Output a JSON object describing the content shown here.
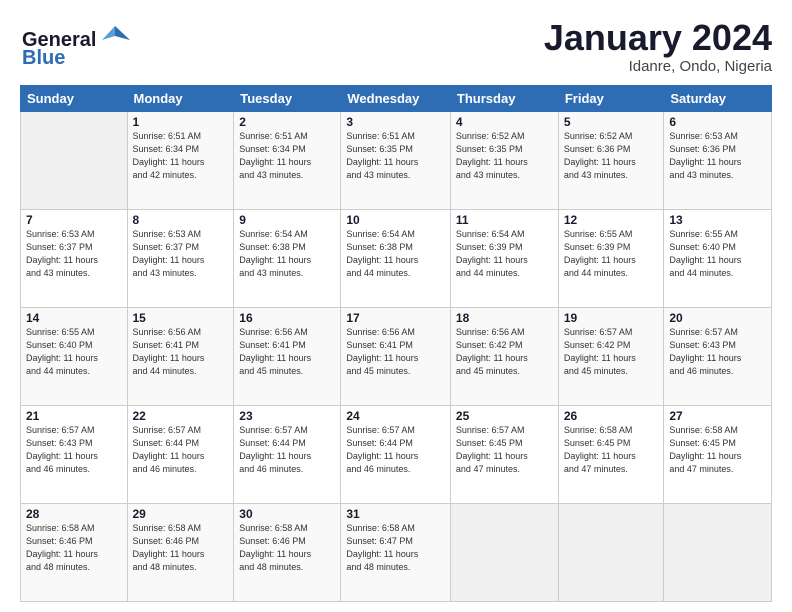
{
  "header": {
    "logo_general": "General",
    "logo_blue": "Blue",
    "month_title": "January 2024",
    "location": "Idanre, Ondo, Nigeria"
  },
  "weekdays": [
    "Sunday",
    "Monday",
    "Tuesday",
    "Wednesday",
    "Thursday",
    "Friday",
    "Saturday"
  ],
  "weeks": [
    [
      {
        "day": "",
        "info": ""
      },
      {
        "day": "1",
        "info": "Sunrise: 6:51 AM\nSunset: 6:34 PM\nDaylight: 11 hours\nand 42 minutes."
      },
      {
        "day": "2",
        "info": "Sunrise: 6:51 AM\nSunset: 6:34 PM\nDaylight: 11 hours\nand 43 minutes."
      },
      {
        "day": "3",
        "info": "Sunrise: 6:51 AM\nSunset: 6:35 PM\nDaylight: 11 hours\nand 43 minutes."
      },
      {
        "day": "4",
        "info": "Sunrise: 6:52 AM\nSunset: 6:35 PM\nDaylight: 11 hours\nand 43 minutes."
      },
      {
        "day": "5",
        "info": "Sunrise: 6:52 AM\nSunset: 6:36 PM\nDaylight: 11 hours\nand 43 minutes."
      },
      {
        "day": "6",
        "info": "Sunrise: 6:53 AM\nSunset: 6:36 PM\nDaylight: 11 hours\nand 43 minutes."
      }
    ],
    [
      {
        "day": "7",
        "info": "Sunrise: 6:53 AM\nSunset: 6:37 PM\nDaylight: 11 hours\nand 43 minutes."
      },
      {
        "day": "8",
        "info": "Sunrise: 6:53 AM\nSunset: 6:37 PM\nDaylight: 11 hours\nand 43 minutes."
      },
      {
        "day": "9",
        "info": "Sunrise: 6:54 AM\nSunset: 6:38 PM\nDaylight: 11 hours\nand 43 minutes."
      },
      {
        "day": "10",
        "info": "Sunrise: 6:54 AM\nSunset: 6:38 PM\nDaylight: 11 hours\nand 44 minutes."
      },
      {
        "day": "11",
        "info": "Sunrise: 6:54 AM\nSunset: 6:39 PM\nDaylight: 11 hours\nand 44 minutes."
      },
      {
        "day": "12",
        "info": "Sunrise: 6:55 AM\nSunset: 6:39 PM\nDaylight: 11 hours\nand 44 minutes."
      },
      {
        "day": "13",
        "info": "Sunrise: 6:55 AM\nSunset: 6:40 PM\nDaylight: 11 hours\nand 44 minutes."
      }
    ],
    [
      {
        "day": "14",
        "info": "Sunrise: 6:55 AM\nSunset: 6:40 PM\nDaylight: 11 hours\nand 44 minutes."
      },
      {
        "day": "15",
        "info": "Sunrise: 6:56 AM\nSunset: 6:41 PM\nDaylight: 11 hours\nand 44 minutes."
      },
      {
        "day": "16",
        "info": "Sunrise: 6:56 AM\nSunset: 6:41 PM\nDaylight: 11 hours\nand 45 minutes."
      },
      {
        "day": "17",
        "info": "Sunrise: 6:56 AM\nSunset: 6:41 PM\nDaylight: 11 hours\nand 45 minutes."
      },
      {
        "day": "18",
        "info": "Sunrise: 6:56 AM\nSunset: 6:42 PM\nDaylight: 11 hours\nand 45 minutes."
      },
      {
        "day": "19",
        "info": "Sunrise: 6:57 AM\nSunset: 6:42 PM\nDaylight: 11 hours\nand 45 minutes."
      },
      {
        "day": "20",
        "info": "Sunrise: 6:57 AM\nSunset: 6:43 PM\nDaylight: 11 hours\nand 46 minutes."
      }
    ],
    [
      {
        "day": "21",
        "info": "Sunrise: 6:57 AM\nSunset: 6:43 PM\nDaylight: 11 hours\nand 46 minutes."
      },
      {
        "day": "22",
        "info": "Sunrise: 6:57 AM\nSunset: 6:44 PM\nDaylight: 11 hours\nand 46 minutes."
      },
      {
        "day": "23",
        "info": "Sunrise: 6:57 AM\nSunset: 6:44 PM\nDaylight: 11 hours\nand 46 minutes."
      },
      {
        "day": "24",
        "info": "Sunrise: 6:57 AM\nSunset: 6:44 PM\nDaylight: 11 hours\nand 46 minutes."
      },
      {
        "day": "25",
        "info": "Sunrise: 6:57 AM\nSunset: 6:45 PM\nDaylight: 11 hours\nand 47 minutes."
      },
      {
        "day": "26",
        "info": "Sunrise: 6:58 AM\nSunset: 6:45 PM\nDaylight: 11 hours\nand 47 minutes."
      },
      {
        "day": "27",
        "info": "Sunrise: 6:58 AM\nSunset: 6:45 PM\nDaylight: 11 hours\nand 47 minutes."
      }
    ],
    [
      {
        "day": "28",
        "info": "Sunrise: 6:58 AM\nSunset: 6:46 PM\nDaylight: 11 hours\nand 48 minutes."
      },
      {
        "day": "29",
        "info": "Sunrise: 6:58 AM\nSunset: 6:46 PM\nDaylight: 11 hours\nand 48 minutes."
      },
      {
        "day": "30",
        "info": "Sunrise: 6:58 AM\nSunset: 6:46 PM\nDaylight: 11 hours\nand 48 minutes."
      },
      {
        "day": "31",
        "info": "Sunrise: 6:58 AM\nSunset: 6:47 PM\nDaylight: 11 hours\nand 48 minutes."
      },
      {
        "day": "",
        "info": ""
      },
      {
        "day": "",
        "info": ""
      },
      {
        "day": "",
        "info": ""
      }
    ]
  ]
}
